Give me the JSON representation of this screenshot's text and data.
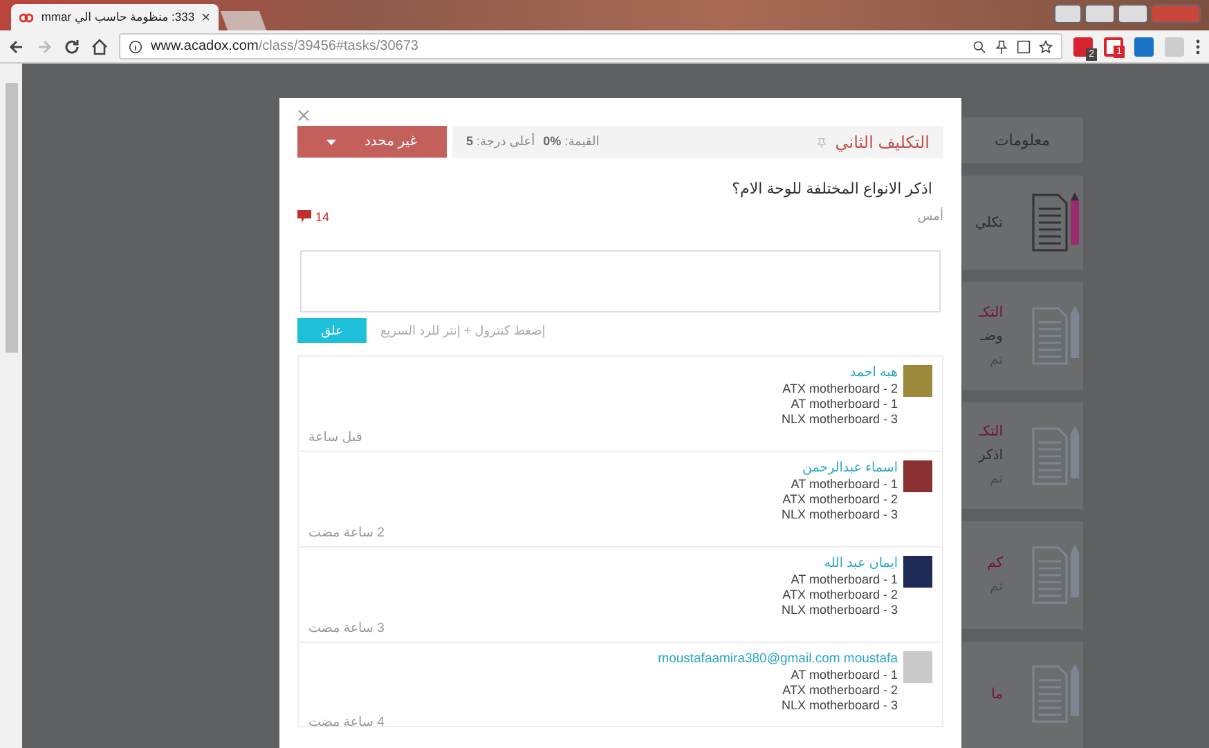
{
  "browser": {
    "tab": {
      "title": "333: منظومة حاسب الي mmar",
      "close": "×"
    },
    "address": {
      "host": "www.acadox.com",
      "path": "/class/39456#tasks/30673"
    },
    "extension_badges": [
      "2",
      "1"
    ]
  },
  "background_page": {
    "side_tab": "معلومات",
    "cards": [
      {
        "kind": "featured",
        "title": "تكلي"
      },
      {
        "kind": "task",
        "title": "التكـ",
        "line": "وضـ",
        "meta": "تم"
      },
      {
        "kind": "task",
        "title": "التكـ",
        "line": "اذكر",
        "meta": "تم"
      },
      {
        "kind": "task",
        "title": "كم",
        "meta": "تم"
      },
      {
        "kind": "task",
        "title": "ما"
      }
    ]
  },
  "modal": {
    "status": {
      "label": "غير محدد"
    },
    "title": "التكليف الثاني",
    "value_label": "القيمة:",
    "value": "%0",
    "max_label": "أعلى درجة:",
    "max": "5",
    "question": "اذكر الانواع المختلفة للوحة الام؟",
    "date": "أمس",
    "comment_count": "14",
    "submit": "علق",
    "hint": "إضغط كنترول + إنتر للرد السريع",
    "replies": [
      {
        "name": "هبه احمد",
        "lines": [
          "ATX motherboard - 2",
          "AT motherboard - 1",
          "NLX motherboard - 3"
        ],
        "time": "قبل ساعة"
      },
      {
        "name": "اسماء عبدالرحمن",
        "lines": [
          "AT motherboard - 1",
          "ATX motherboard - 2",
          "NLX motherboard - 3"
        ],
        "time": "2 ساعة مضت"
      },
      {
        "name": "ايمان عبد الله",
        "lines": [
          "AT motherboard - 1",
          "ATX motherboard - 2",
          "NLX motherboard - 3"
        ],
        "time": "3 ساعة مضت"
      },
      {
        "name": "moustafaamira380@gmail.com moustafa",
        "lines": [
          "AT motherboard - 1",
          "ATX motherboard - 2",
          "NLX motherboard - 3"
        ],
        "time": "4 ساعة مضت"
      }
    ]
  }
}
